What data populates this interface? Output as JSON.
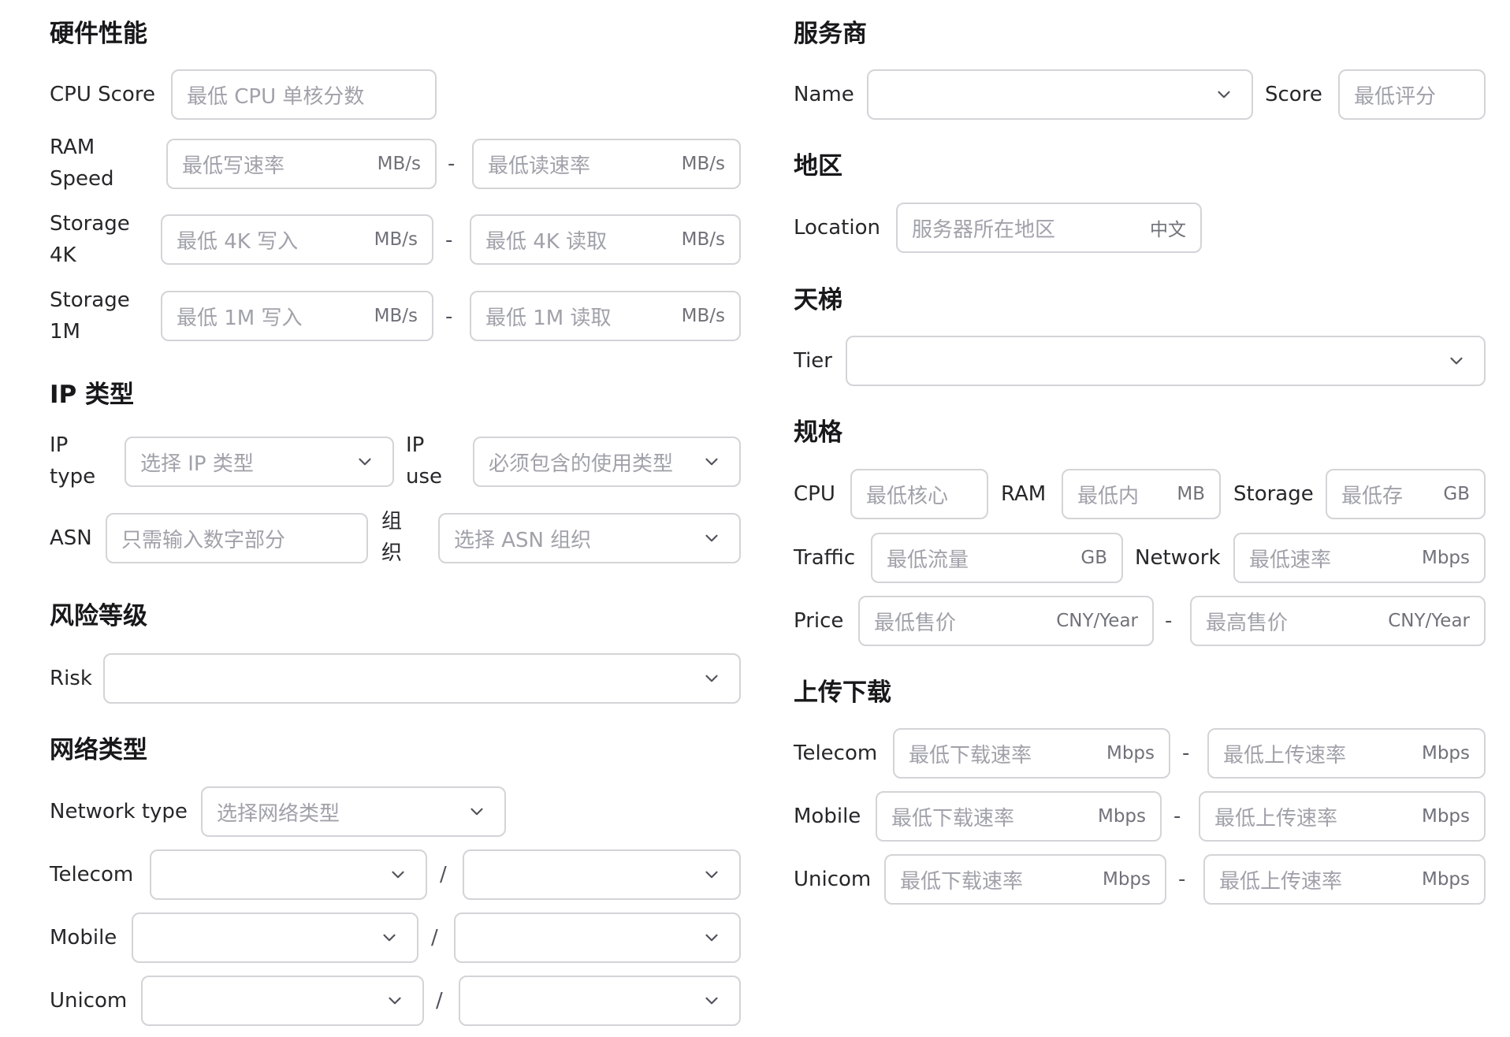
{
  "colors": {
    "border": "#d4d4d8",
    "placeholder": "#a1a1aa",
    "unit": "#71717a",
    "heading": "#18181b"
  },
  "hardware": {
    "title": "硬件性能",
    "cpu": {
      "label": "CPU Score",
      "placeholder": "最低 CPU 单核分数"
    },
    "ram": {
      "label_l1": "RAM",
      "label_l2": "Speed",
      "min_write": "最低写速率",
      "min_read": "最低读速率",
      "unit": "MB/s",
      "sep": "-"
    },
    "storage4k": {
      "label_l1": "Storage",
      "label_l2": "4K",
      "min_write": "最低 4K 写入",
      "min_read": "最低 4K 读取",
      "unit": "MB/s",
      "sep": "-"
    },
    "storage1m": {
      "label_l1": "Storage",
      "label_l2": "1M",
      "min_write": "最低 1M 写入",
      "min_read": "最低 1M 读取",
      "unit": "MB/s",
      "sep": "-"
    }
  },
  "ip": {
    "title": "IP 类型",
    "type": {
      "label_l1": "IP",
      "label_l2": "type",
      "placeholder": "选择 IP 类型"
    },
    "use": {
      "label_l1": "IP",
      "label_l2": "use",
      "placeholder": "必须包含的使用类型"
    },
    "asn": {
      "label": "ASN",
      "placeholder": "只需输入数字部分"
    },
    "org": {
      "label_l1": "组",
      "label_l2": "织",
      "placeholder": "选择 ASN 组织"
    }
  },
  "risk": {
    "title": "风险等级",
    "label": "Risk",
    "value": ""
  },
  "network": {
    "title": "网络类型",
    "type": {
      "label": "Network type",
      "placeholder": "选择网络类型"
    },
    "telecom": {
      "label": "Telecom",
      "sep": "/"
    },
    "mobile": {
      "label": "Mobile",
      "sep": "/"
    },
    "unicom": {
      "label": "Unicom",
      "sep": "/"
    }
  },
  "provider": {
    "title": "服务商",
    "name": {
      "label": "Name",
      "value": ""
    },
    "score": {
      "label": "Score",
      "placeholder": "最低评分"
    }
  },
  "region": {
    "title": "地区",
    "location": {
      "label": "Location",
      "placeholder": "服务器所在地区",
      "lang": "中文"
    }
  },
  "ladder": {
    "title": "天梯",
    "tier": {
      "label": "Tier",
      "value": ""
    }
  },
  "spec": {
    "title": "规格",
    "cpu": {
      "label": "CPU",
      "placeholder": "最低核心"
    },
    "ram": {
      "label": "RAM",
      "placeholder": "最低内",
      "unit": "MB"
    },
    "storage": {
      "label": "Storage",
      "placeholder": "最低存",
      "unit": "GB"
    },
    "traffic": {
      "label": "Traffic",
      "placeholder": "最低流量",
      "unit": "GB"
    },
    "network": {
      "label": "Network",
      "placeholder": "最低速率",
      "unit": "Mbps"
    },
    "price": {
      "label": "Price",
      "min": "最低售价",
      "max": "最高售价",
      "unit": "CNY/Year",
      "sep": "-"
    }
  },
  "updown": {
    "title": "上传下载",
    "telecom": {
      "label": "Telecom",
      "down": "最低下载速率",
      "up": "最低上传速率",
      "unit": "Mbps",
      "sep": "-"
    },
    "mobile": {
      "label": "Mobile",
      "down": "最低下载速率",
      "up": "最低上传速率",
      "unit": "Mbps",
      "sep": "-"
    },
    "unicom": {
      "label": "Unicom",
      "down": "最低下载速率",
      "up": "最低上传速率",
      "unit": "Mbps",
      "sep": "-"
    }
  }
}
